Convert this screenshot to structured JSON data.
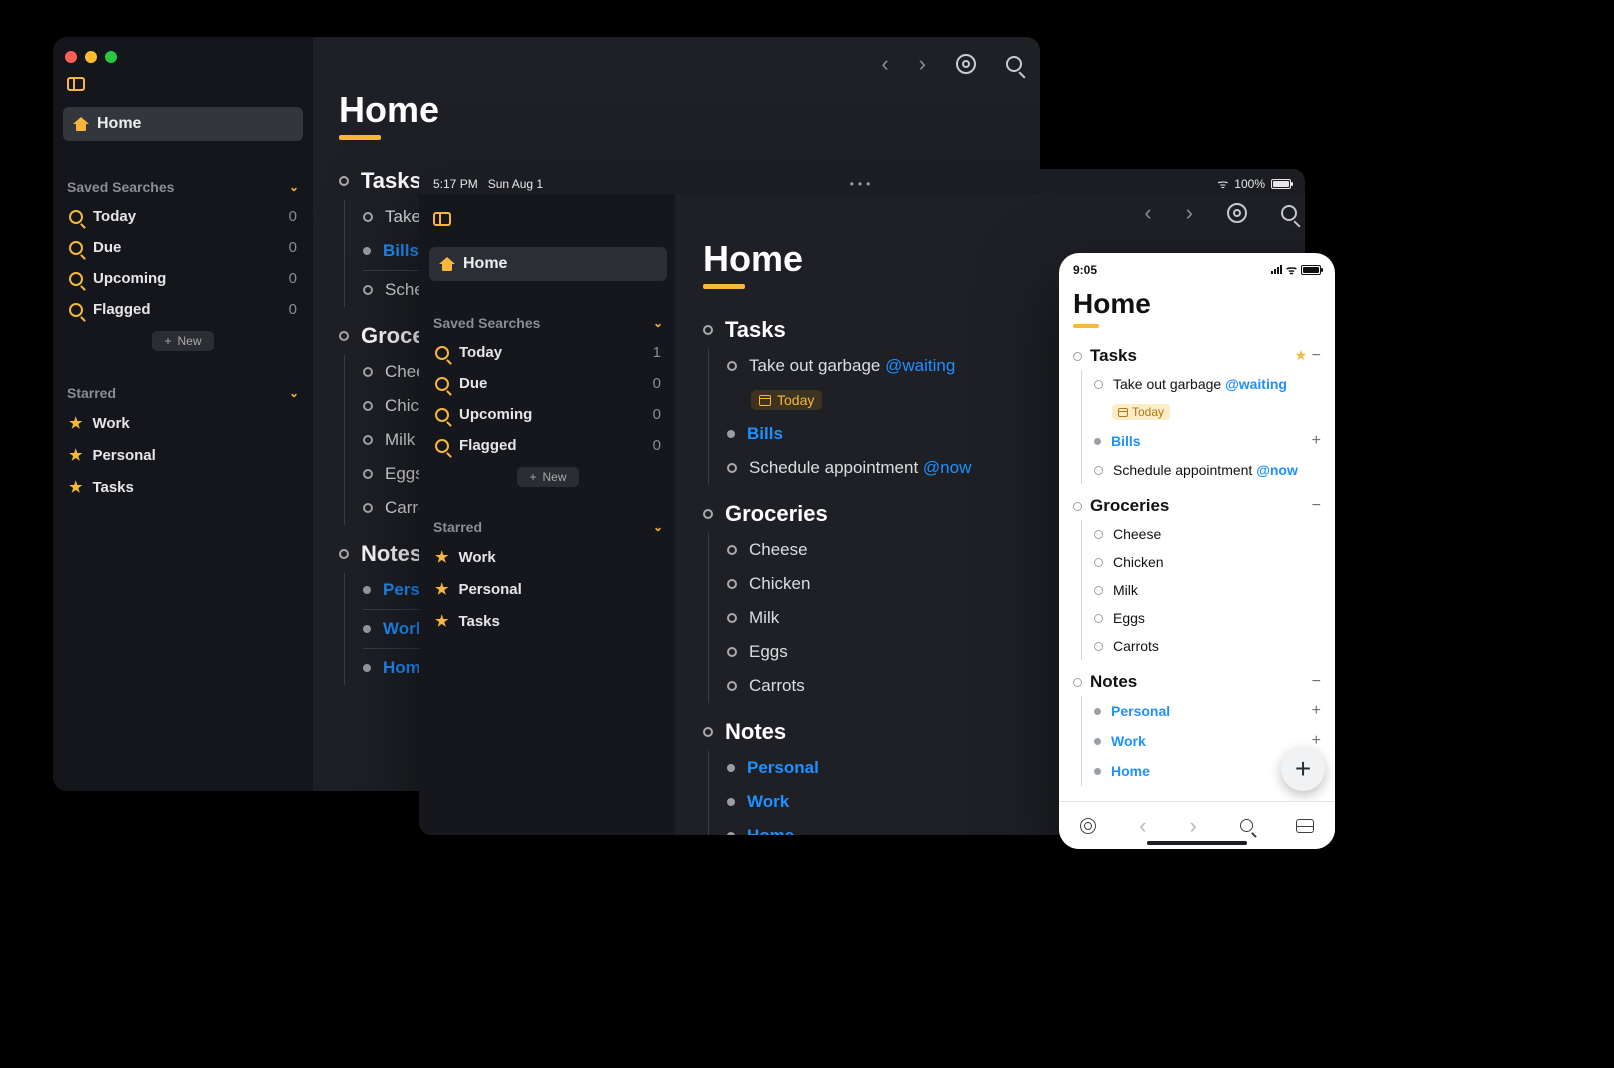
{
  "mac": {
    "sidebar": {
      "home_label": "Home",
      "saved_head": "Saved Searches",
      "saved": [
        {
          "label": "Today",
          "count": 0
        },
        {
          "label": "Due",
          "count": 0
        },
        {
          "label": "Upcoming",
          "count": 0
        },
        {
          "label": "Flagged",
          "count": 0
        }
      ],
      "new_label": "New",
      "starred_head": "Starred",
      "starred": [
        {
          "label": "Work"
        },
        {
          "label": "Personal"
        },
        {
          "label": "Tasks"
        }
      ]
    },
    "main": {
      "title": "Home",
      "groups": [
        {
          "title": "Tasks",
          "items": [
            {
              "label": "Take out garbage",
              "link": false,
              "bullet": "open"
            },
            {
              "label": "Bills",
              "link": true,
              "bullet": "closed",
              "div_after": true
            },
            {
              "label": "Schedule appointment",
              "link": false,
              "bullet": "open"
            }
          ]
        },
        {
          "title": "Groceries",
          "items": [
            {
              "label": "Cheese",
              "bullet": "open"
            },
            {
              "label": "Chicken",
              "bullet": "open"
            },
            {
              "label": "Milk",
              "bullet": "open"
            },
            {
              "label": "Eggs",
              "bullet": "open"
            },
            {
              "label": "Carrots",
              "bullet": "open"
            }
          ]
        },
        {
          "title": "Notes",
          "items": [
            {
              "label": "Personal",
              "link": true,
              "bullet": "closed",
              "div_after": true
            },
            {
              "label": "Work",
              "link": true,
              "bullet": "closed",
              "div_after": true
            },
            {
              "label": "Home",
              "link": true,
              "bullet": "closed"
            }
          ]
        }
      ]
    }
  },
  "ipad": {
    "status": {
      "time": "5:17 PM",
      "date": "Sun Aug 1",
      "battery": "100%"
    },
    "sidebar": {
      "home_label": "Home",
      "saved_head": "Saved Searches",
      "saved": [
        {
          "label": "Today",
          "count": 1
        },
        {
          "label": "Due",
          "count": 0
        },
        {
          "label": "Upcoming",
          "count": 0
        },
        {
          "label": "Flagged",
          "count": 0
        }
      ],
      "new_label": "New",
      "starred_head": "Starred",
      "starred": [
        {
          "label": "Work"
        },
        {
          "label": "Personal"
        },
        {
          "label": "Tasks"
        }
      ]
    },
    "content": {
      "title": "Home",
      "tasks_title": "Tasks",
      "tasks": {
        "garbage": "Take out garbage",
        "tag_waiting": "@waiting",
        "today": "Today",
        "bills": "Bills",
        "schedule": "Schedule appointment",
        "tag_now": "@now"
      },
      "groceries_title": "Groceries",
      "groceries": [
        "Cheese",
        "Chicken",
        "Milk",
        "Eggs",
        "Carrots"
      ],
      "notes_title": "Notes",
      "notes": [
        "Personal",
        "Work",
        "Home"
      ]
    }
  },
  "iphone": {
    "status": {
      "time": "9:05"
    },
    "title": "Home",
    "tasks_title": "Tasks",
    "tasks": {
      "garbage": "Take out garbage",
      "tag_waiting": "@waiting",
      "today": "Today",
      "bills": "Bills",
      "schedule": "Schedule appointment",
      "tag_now": "@now"
    },
    "groceries_title": "Groceries",
    "groceries": [
      "Cheese",
      "Chicken",
      "Milk",
      "Eggs",
      "Carrots"
    ],
    "notes_title": "Notes",
    "notes": [
      "Personal",
      "Work",
      "Home"
    ]
  }
}
